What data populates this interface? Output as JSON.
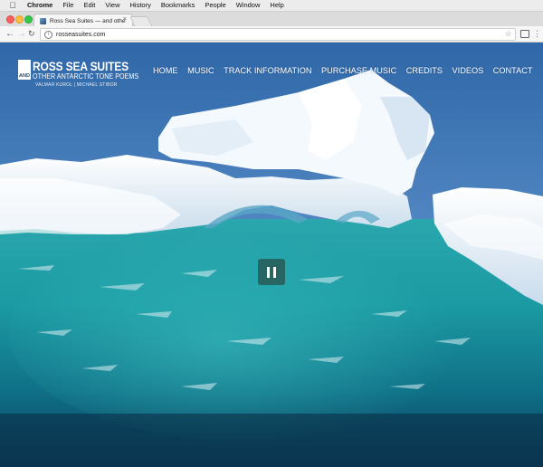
{
  "menubar": {
    "items": [
      "Chrome",
      "File",
      "Edit",
      "View",
      "History",
      "Bookmarks",
      "People",
      "Window",
      "Help"
    ]
  },
  "browser": {
    "tab_title": "Ross Sea Suites — and other A",
    "tab_close": "×",
    "url": "rosseasuites.com",
    "star": "☆",
    "menu": "⋮"
  },
  "site": {
    "logo_line1": "ROSS SEA SUITES",
    "logo_and": "AND",
    "logo_line2": "OTHER ANTARCTIC TONE POEMS",
    "logo_line3": "VALMAR KUROL | MICHAEL STIBOR",
    "nav": [
      "HOME",
      "MUSIC",
      "TRACK INFORMATION",
      "PURCHASE MUSIC",
      "CREDITS",
      "VIDEOS",
      "CONTACT"
    ]
  },
  "colors": {
    "sky": "#3f78b8",
    "water": "#1d9aa2",
    "ice": "#eef5fa"
  }
}
